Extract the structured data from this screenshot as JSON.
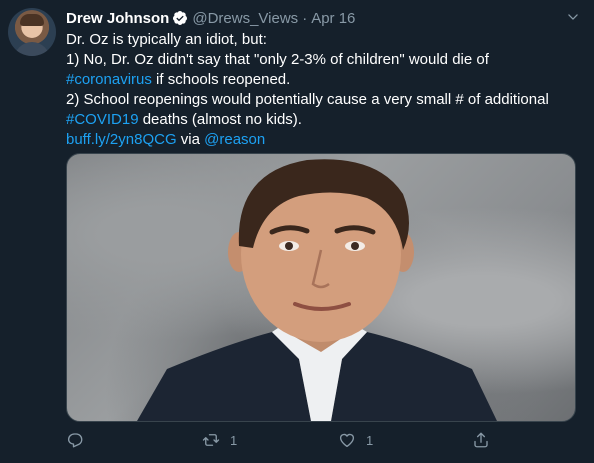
{
  "author": {
    "name": "Drew Johnson",
    "handle": "@Drews_Views",
    "separator": "·",
    "date": "Apr 16"
  },
  "tweet": {
    "line1": "Dr. Oz is typically an idiot, but:",
    "line2": "1) No, Dr. Oz didn't say that \"only 2-3% of children\" would die of",
    "line3_link": "#coronavirus",
    "line3_rest": " if schools reopened.",
    "line4": "2) School reopenings would potentially cause a very small # of additional",
    "line5_link": "#COVID19",
    "line5_rest": " deaths (almost no kids).",
    "line6_link": "buff.ly/2yn8QCG",
    "line6_mid": " via ",
    "line6_mention": "@reason"
  },
  "actions": {
    "reply_count": "",
    "retweet_count": "1",
    "like_count": "1"
  },
  "icons": {
    "avatar": "avatar-photo",
    "verified": "verified-badge-icon",
    "caret": "chevron-down-icon",
    "reply": "reply-icon",
    "retweet": "retweet-icon",
    "like": "heart-icon",
    "share": "share-icon"
  },
  "colors": {
    "background": "#15202b",
    "link": "#1da1f2",
    "muted": "#8899a6"
  }
}
